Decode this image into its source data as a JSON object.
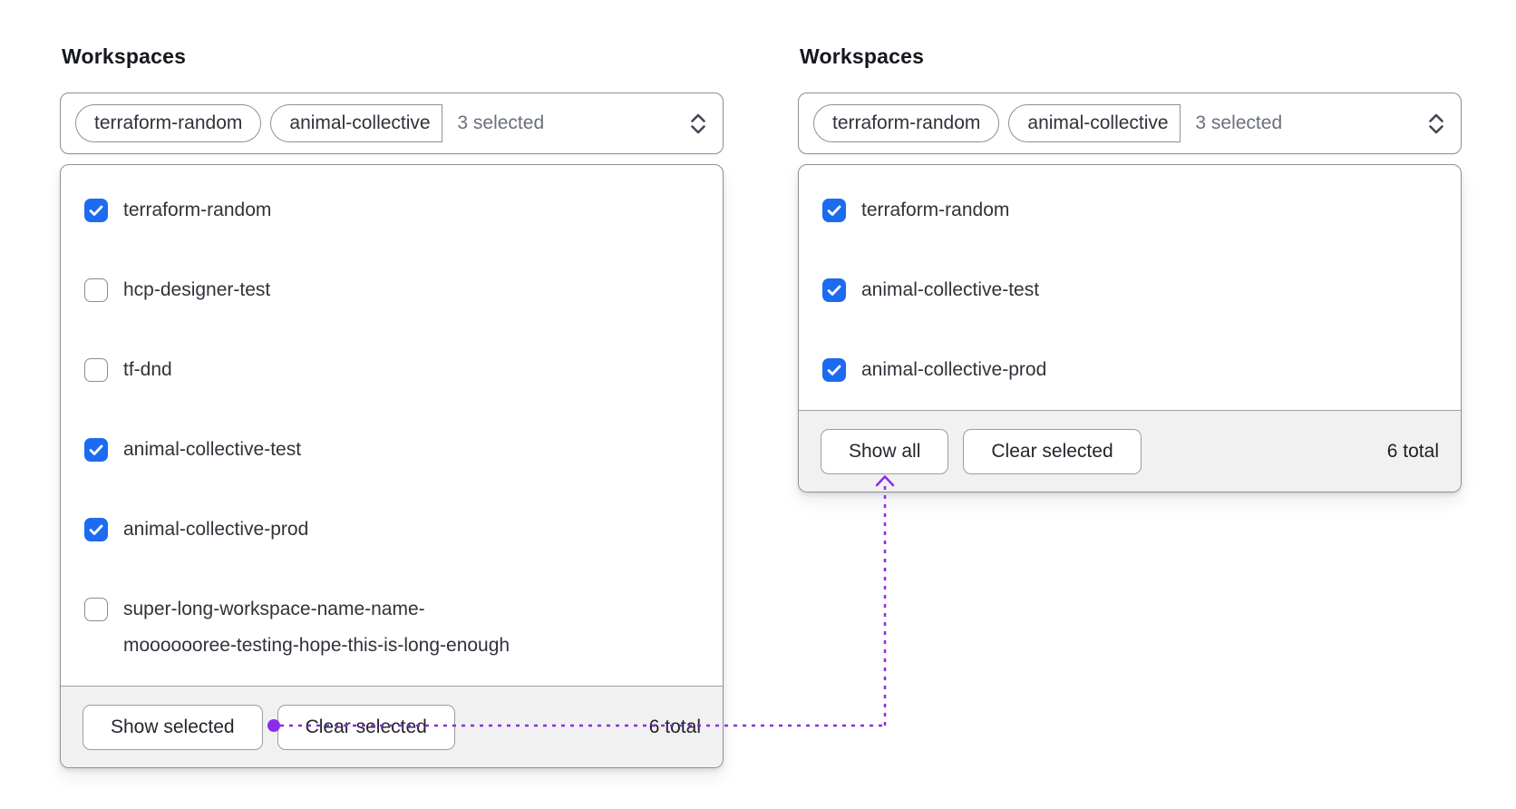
{
  "colors": {
    "checkbox_blue": "#1c6bf0",
    "annotation_purple": "#8c2ce8"
  },
  "left_panel": {
    "title": "Workspaces",
    "trigger": {
      "tags": [
        "terraform-random",
        "animal-collective"
      ],
      "summary": "3 selected"
    },
    "options": [
      {
        "label": "terraform-random",
        "checked": true
      },
      {
        "label": "hcp-designer-test",
        "checked": false
      },
      {
        "label": "tf-dnd",
        "checked": false
      },
      {
        "label": "animal-collective-test",
        "checked": true
      },
      {
        "label": "animal-collective-prod",
        "checked": true
      },
      {
        "label": "super-long-workspace-name-name-mooooooree-testing-hope-this-is-long-enough",
        "checked": false
      }
    ],
    "footer": {
      "primary_label": "Show selected",
      "clear_label": "Clear selected",
      "total": "6 total"
    }
  },
  "right_panel": {
    "title": "Workspaces",
    "trigger": {
      "tags": [
        "terraform-random",
        "animal-collective"
      ],
      "summary": "3 selected"
    },
    "options": [
      {
        "label": "terraform-random",
        "checked": true
      },
      {
        "label": "animal-collective-test",
        "checked": true
      },
      {
        "label": "animal-collective-prod",
        "checked": true
      }
    ],
    "footer": {
      "primary_label": "Show all",
      "clear_label": "Clear selected",
      "total": "6 total"
    }
  }
}
